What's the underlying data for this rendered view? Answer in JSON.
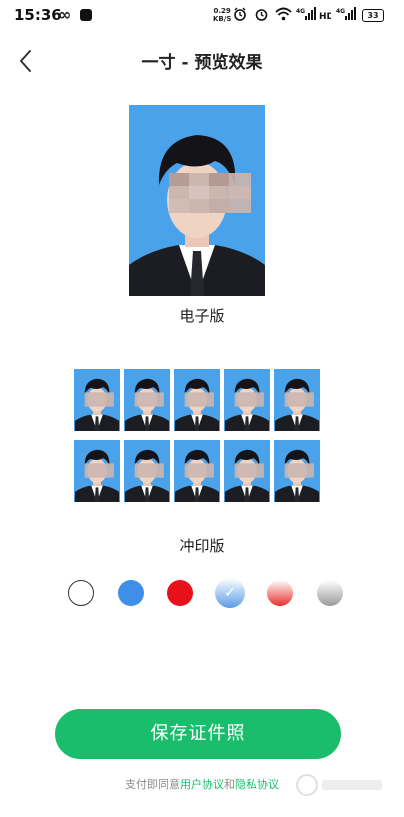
{
  "status": {
    "time": "15:36",
    "net_speed_value": "0.29",
    "net_speed_unit": "KB/S",
    "battery": "33"
  },
  "header": {
    "title": "一寸 - 预览效果",
    "back_icon": "chevron-left-icon"
  },
  "electronic": {
    "label": "电子版"
  },
  "print": {
    "label": "冲印版",
    "rows": 2,
    "columns": 5
  },
  "background_colors": [
    {
      "name": "white",
      "color": "#ffffff",
      "selected": false
    },
    {
      "name": "blue",
      "color": "#3f8ee8",
      "selected": false
    },
    {
      "name": "red",
      "color": "#e8101a",
      "selected": false
    },
    {
      "name": "blue-gradient",
      "color": "#5b9de6",
      "selected": true
    },
    {
      "name": "red-gradient",
      "color": "#e8302f",
      "selected": false
    },
    {
      "name": "gray-gradient",
      "color": "#9a9a9a",
      "selected": false
    }
  ],
  "colors": {
    "accent": "#19bd6c",
    "photo_background": "#4aa2ea"
  },
  "actions": {
    "save_label": "保存证件照"
  },
  "agreement": {
    "prefix": "支付即同意",
    "user_agreement": "用户协议",
    "and": "和",
    "privacy_agreement": "隐私协议"
  }
}
